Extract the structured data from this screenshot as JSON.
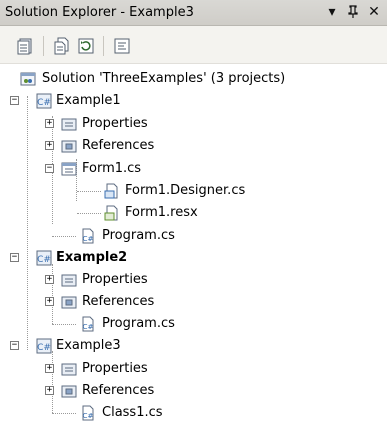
{
  "window": {
    "title": "Solution Explorer - Example3",
    "buttons": {
      "dropdown": "▾",
      "pin": "ᵽ",
      "close": "✕"
    }
  },
  "toolbar": {
    "tools": [
      "properties-icon",
      "show-all-files-icon",
      "refresh-icon",
      "view-code-icon"
    ]
  },
  "tree": {
    "solution": "Solution 'ThreeExamples' (3 projects)",
    "projects": [
      {
        "name": "Example1",
        "bold": false,
        "items": {
          "properties": "Properties",
          "references": "References",
          "form": "Form1.cs",
          "form_designer": "Form1.Designer.cs",
          "form_resx": "Form1.resx",
          "program": "Program.cs"
        }
      },
      {
        "name": "Example2",
        "bold": true,
        "items": {
          "properties": "Properties",
          "references": "References",
          "program": "Program.cs"
        }
      },
      {
        "name": "Example3",
        "bold": false,
        "items": {
          "properties": "Properties",
          "references": "References",
          "class": "Class1.cs"
        }
      }
    ]
  },
  "colors": {
    "titlebar": "#d4d2cc",
    "toolbar": "#f4f3ef",
    "tree_lines": "#9a9a9a",
    "cs_icon": "#3a6fb0"
  }
}
